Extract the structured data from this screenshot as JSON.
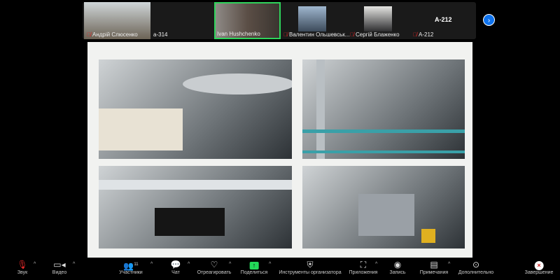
{
  "participants": [
    {
      "name": "Андрій Слюсенко",
      "muted": true
    },
    {
      "name": "а-314",
      "muted": false
    },
    {
      "name": "Ivan Hushchenko",
      "muted": false,
      "active_speaker": true
    },
    {
      "name": "Валентин Ольшевськ...",
      "muted": true
    },
    {
      "name": "Сергій Блаженко",
      "muted": true
    },
    {
      "name": "А-212",
      "muted": true,
      "big_label": "А-212"
    }
  ],
  "colors": {
    "active_speaker": "#2fd35b",
    "accent": "#0e72ed",
    "end": "#d02020"
  },
  "toolbar": {
    "mute": "Звук",
    "video": "Видео",
    "participants": "Участники",
    "participants_count": "11",
    "chat": "Чат",
    "react": "Отреагировать",
    "share": "Поделиться",
    "host_tools": "Инструменты организатора",
    "apps": "Приложения",
    "record": "Запись",
    "notes": "Примечания",
    "more": "Дополнительно",
    "end": "Завершение"
  }
}
